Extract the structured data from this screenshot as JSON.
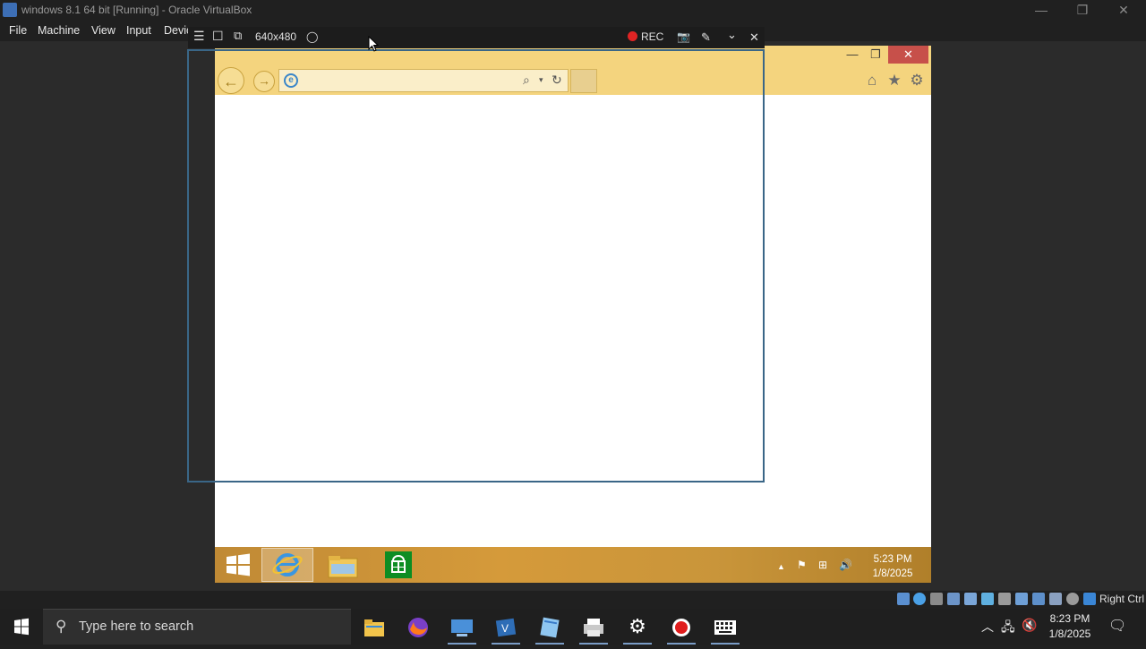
{
  "host_window": {
    "title": "windows 8.1 64 bit [Running] - Oracle VirtualBox",
    "controls": {
      "minimize": "—",
      "restore": "❐",
      "close": "✕"
    }
  },
  "menu": {
    "items": [
      "File",
      "Machine",
      "View",
      "Input",
      "Devic"
    ]
  },
  "mini_toolbar": {
    "menu_icon": "☰",
    "fullscreen_icon": "☐",
    "scale_icon": "⧉",
    "resolution": "640x480",
    "drop_icon": "◯",
    "rec_label": "REC",
    "camera_icon": "📷",
    "pen_icon": "✎",
    "collapse_icon": "⌄",
    "close_icon": "✕"
  },
  "browser": {
    "back_icon": "←",
    "forward_icon": "→",
    "address_value": "",
    "ie_logo": "e",
    "search_icon": "⌕",
    "dropdown_icon": "▾",
    "refresh_icon": "↻",
    "home_icon": "⌂",
    "favorites_icon": "★",
    "tools_icon": "⚙",
    "minimize": "—",
    "restore": "❐",
    "close": "✕"
  },
  "guest_taskbar": {
    "time": "5:23 PM",
    "date": "1/8/2025",
    "tray_up": "▲",
    "flag_icon": "⚑",
    "network_icon": "⊞",
    "volume_icon": "🔊"
  },
  "vbox_status": {
    "host_key": "Right Ctrl"
  },
  "host_taskbar": {
    "search_placeholder": "Type here to search",
    "time": "8:23 PM",
    "date": "1/8/2025",
    "tray_up": "︿",
    "network_icon": "🖧",
    "volume_icon": "🔇",
    "notification_icon": "🗨"
  },
  "colors": {
    "ie_chrome": "#f4d47e",
    "rec_red": "#e02424",
    "close_red": "#c7504a",
    "guest_taskbar": "#d59a3a"
  }
}
